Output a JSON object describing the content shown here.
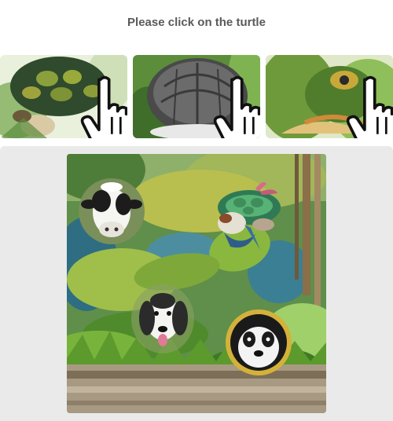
{
  "prompt": "Please click on the turtle",
  "examples": [
    {
      "name": "turtle-example-1"
    },
    {
      "name": "turtle-example-2"
    },
    {
      "name": "turtle-example-3"
    }
  ],
  "scene": {
    "animals": [
      "cow",
      "turtle",
      "dog",
      "panda"
    ]
  }
}
